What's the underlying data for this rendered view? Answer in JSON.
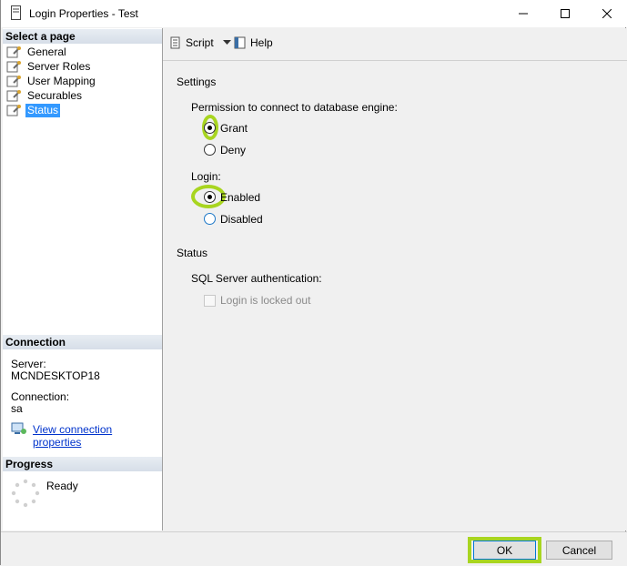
{
  "window": {
    "title": "Login Properties - Test"
  },
  "select_page": {
    "heading": "Select a page",
    "items": [
      {
        "label": "General",
        "selected": false
      },
      {
        "label": "Server Roles",
        "selected": false
      },
      {
        "label": "User Mapping",
        "selected": false
      },
      {
        "label": "Securables",
        "selected": false
      },
      {
        "label": "Status",
        "selected": true
      }
    ]
  },
  "connection": {
    "heading": "Connection",
    "server_label": "Server:",
    "server_value": "MCNDESKTOP18",
    "connection_label": "Connection:",
    "connection_value": "sa",
    "link_label": "View connection properties"
  },
  "progress": {
    "heading": "Progress",
    "status": "Ready"
  },
  "toolbar": {
    "script_label": "Script",
    "help_label": "Help"
  },
  "settings": {
    "heading": "Settings",
    "permission_label": "Permission to connect to database engine:",
    "grant_label": "Grant",
    "deny_label": "Deny",
    "permission_selected": "Grant",
    "login_label": "Login:",
    "enabled_label": "Enabled",
    "disabled_label": "Disabled",
    "login_selected": "Enabled"
  },
  "status": {
    "heading": "Status",
    "sql_auth_label": "SQL Server authentication:",
    "locked_out_label": "Login is locked out",
    "locked_out_checked": false
  },
  "buttons": {
    "ok_label": "OK",
    "cancel_label": "Cancel"
  },
  "colors": {
    "highlight": "#a8d520",
    "selection": "#3399ff",
    "link": "#0033cc"
  }
}
